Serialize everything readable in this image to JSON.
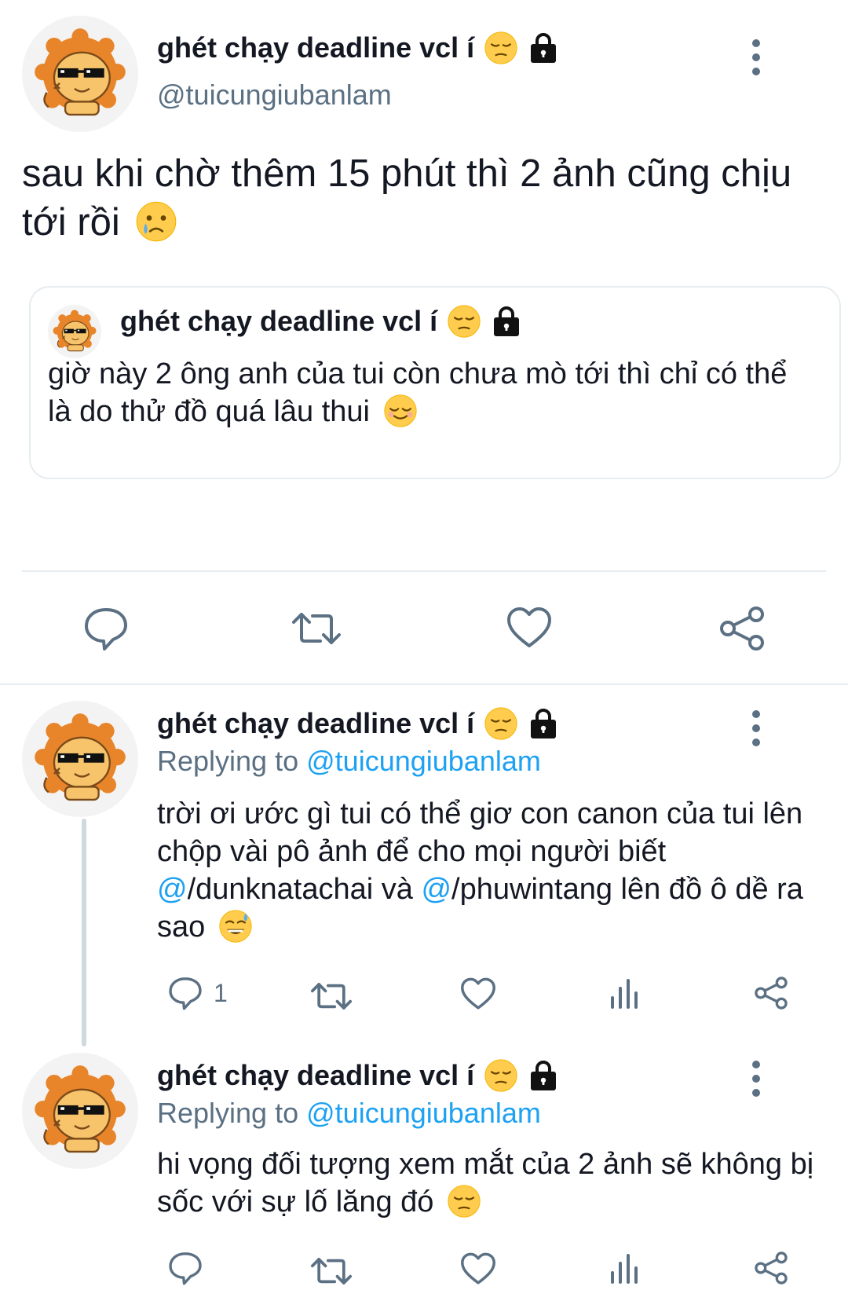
{
  "main_tweet": {
    "display_name": "ghét chạy deadline vcl í",
    "handle": "@tuicungiubanlam",
    "text": "sau khi chờ thêm 15 phút thì 2 ảnh cũng chịu tới rồi",
    "quoted": {
      "display_name": "ghét chạy deadline vcl í",
      "text": "giờ này 2 ông anh của tui còn chưa mò tới thì chỉ có thể là do thử đồ quá lâu thui"
    }
  },
  "replies": [
    {
      "display_name": "ghét chạy deadline vcl í",
      "replying_label": "Replying to",
      "replying_to": "@tuicungiubanlam",
      "text_part1": "trời ơi ước gì tui có thể giơ con canon của tui lên chộp vài pô ảnh để cho mọi người biết ",
      "at1": "@",
      "mention1": "/dunknatachai",
      "text_part2": " và ",
      "at2": "@",
      "mention2": "/phuwintang",
      "text_part3": " lên đồ ô dề ra sao",
      "reply_count": "1"
    },
    {
      "display_name": "ghét chạy deadline vcl í",
      "replying_label": "Replying to",
      "replying_to": "@tuicungiubanlam",
      "text": "hi vọng đối tượng xem mắt của 2 ảnh sẽ không bị sốc với sự lố lăng đó"
    }
  ],
  "icons": {
    "reply": "reply-icon",
    "retweet": "retweet-icon",
    "like": "heart-icon",
    "share": "share-icon",
    "analytics": "analytics-icon",
    "more": "more-vertical-icon",
    "lock": "lock-icon"
  },
  "colors": {
    "text": "#141823",
    "secondary": "#5b7083",
    "link": "#1da1f2",
    "border": "#e6ecf0",
    "lion_orange": "#f0a640",
    "lion_mane": "#e8852a"
  }
}
